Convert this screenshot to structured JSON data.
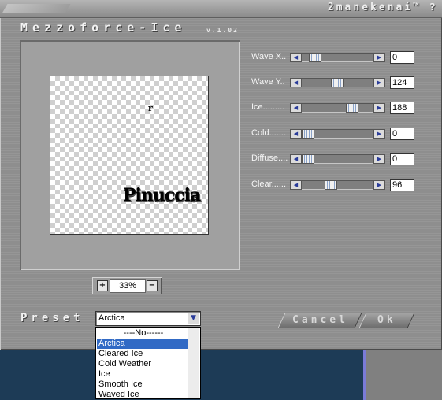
{
  "window": {
    "brand": "2manekenai™",
    "help_label": "?",
    "title": "Mezzoforce-Ice",
    "version": "v.1.02"
  },
  "preview": {
    "artwork_mark": "r",
    "artwork_text": "Pinuccia"
  },
  "zoom": {
    "plus_label": "+",
    "value": "33%",
    "minus_label": "−"
  },
  "sliders": [
    {
      "label": "Wave X..",
      "value": "0",
      "level": 0.12
    },
    {
      "label": "Wave Y..",
      "value": "124",
      "level": 0.49
    },
    {
      "label": "Ice.........",
      "value": "188",
      "level": 0.74
    },
    {
      "label": "Cold.......",
      "value": "0",
      "level": 0.0
    },
    {
      "label": "Diffuse....",
      "value": "0",
      "level": 0.0
    },
    {
      "label": "Clear......",
      "value": "96",
      "level": 0.38
    }
  ],
  "preset": {
    "label": "Preset",
    "selected": "Arctica",
    "options": [
      "----No------",
      "Arctica",
      "Cleared Ice",
      "Cold Weather",
      "Ice",
      "Smooth Ice",
      "Waved Ice"
    ]
  },
  "buttons": {
    "cancel": "Cancel",
    "ok": "Ok"
  },
  "icons": {
    "slider_left": "left-arrow-icon",
    "slider_right": "right-arrow-icon",
    "dropdown": "chevron-down-icon"
  }
}
